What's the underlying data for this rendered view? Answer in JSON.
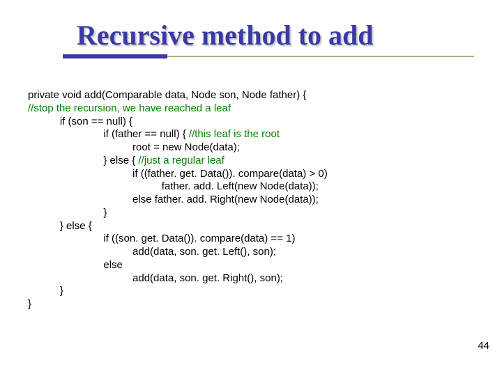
{
  "title": "Recursive method to add",
  "code": {
    "l1": "private void add(Comparable data, Node son, Node father) {",
    "l2": "//stop the recursion, we have reached a leaf",
    "l3": "           if (son == null) {",
    "l4a": "                          if (father == null) { ",
    "l4b": "//this leaf is the root",
    "l5": "                                    root = new Node(data);",
    "l6a": "                          } else { ",
    "l6b": "//just a regular leaf",
    "l7": "                                    if ((father. get. Data()). compare(data) > 0)",
    "l8": "                                              father. add. Left(new Node(data));",
    "l9": "                                    else father. add. Right(new Node(data));",
    "l10": "                          }",
    "l11": "           } else {",
    "l12": "                          if ((son. get. Data()). compare(data) == 1)",
    "l13": "                                    add(data, son. get. Left(), son);",
    "l14": "                          else",
    "l15": "                                    add(data, son. get. Right(), son);",
    "l16": "           }",
    "l17": "}"
  },
  "page_number": "44"
}
